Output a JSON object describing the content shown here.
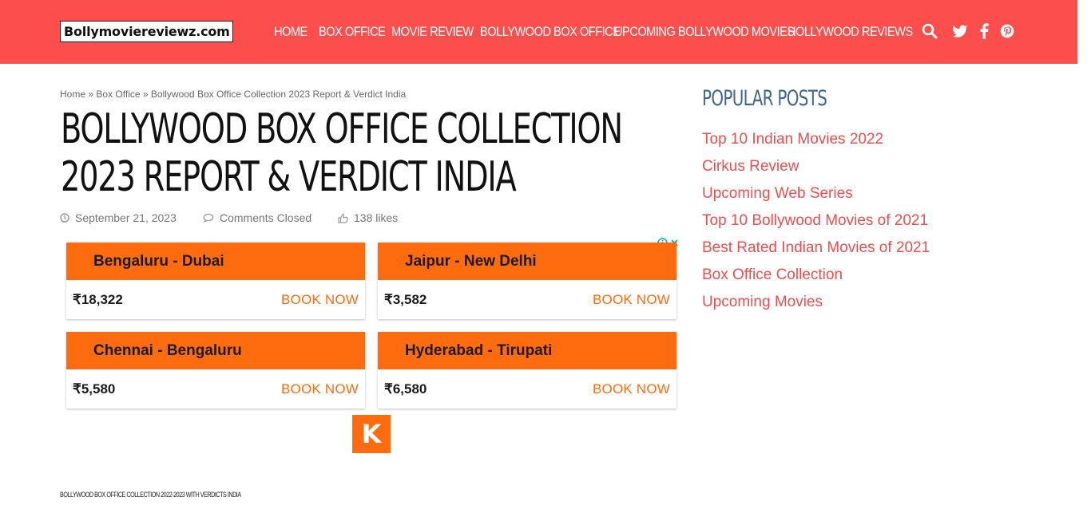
{
  "header": {
    "logo_text": "Bollymoviereviewz.com",
    "nav": [
      "Home",
      "Box Office",
      "Movie Review",
      "Bollywood Box Office",
      "Upcoming Bollywood Movies",
      "Hollywood Reviews"
    ],
    "icons": [
      "search-icon",
      "twitter-icon",
      "facebook-icon",
      "pinterest-icon"
    ],
    "bg_color": "#fd4e4e"
  },
  "breadcrumb": {
    "home": "Home",
    "sep1": "»",
    "box_office": "Box Office",
    "sep2": "»",
    "current": "Bollywood Box Office Collection 2023 Report & Verdict India"
  },
  "article": {
    "title_line1": "Bollywood Box Office Collection",
    "title_line2": "2023 Report & Verdict India",
    "date": "September 21, 2023",
    "comments": "Comments Closed",
    "likes": "138 likes",
    "subheading": "Bollywood Box office collection 2022-2023 with verdicts India"
  },
  "ad": {
    "accent": "#ff6b0f",
    "cards": [
      {
        "route": "Bengaluru - Dubai",
        "price": "₹18,322",
        "cta": "BOOK NOW"
      },
      {
        "route": "Jaipur - New Delhi",
        "price": "₹3,582",
        "cta": "BOOK NOW"
      },
      {
        "route": "Chennai - Bengaluru",
        "price": "₹5,580",
        "cta": "BOOK NOW"
      },
      {
        "route": "Hyderabad - Tirupati",
        "price": "₹6,580",
        "cta": "BOOK NOW"
      }
    ],
    "brand_letter": "K"
  },
  "sidebar": {
    "title": "Popular Posts",
    "links": [
      "Top 10 Indian Movies 2022",
      "Cirkus Review",
      "Upcoming Web Series",
      "Top 10 Bollywood Movies of 2021",
      "Best Rated Indian Movies of 2021",
      "Box Office Collection",
      "Upcoming Movies"
    ]
  }
}
